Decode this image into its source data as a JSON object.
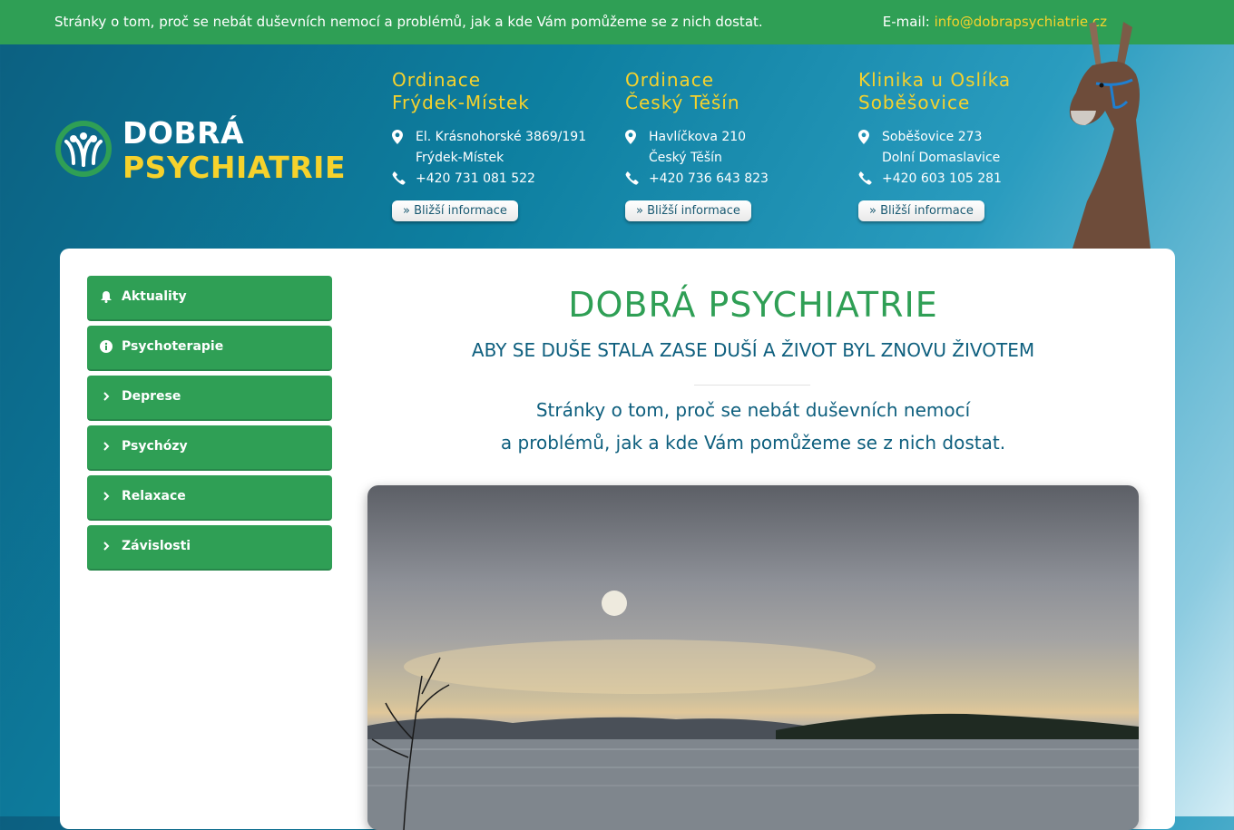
{
  "topbar": {
    "tagline": "Stránky o tom, proč se nebát duševních nemocí a problémů, jak a kde Vám pomůžeme se z nich dostat.",
    "email_label": "E-mail:",
    "email": "info@dobrapsychiatrie.cz"
  },
  "logo": {
    "line1": "DOBRÁ",
    "line2": "PSYCHIATRIE"
  },
  "clinics": [
    {
      "title1": "Ordinace",
      "title2": "Frýdek-Místek",
      "addr1": "El. Krásnohorské 3869/191",
      "addr2": "Frýdek-Místek",
      "phone": "+420 731 081 522",
      "button": "Bližší informace"
    },
    {
      "title1": "Ordinace",
      "title2": "Český Těšín",
      "addr1": "Havlíčkova 210",
      "addr2": "Český Těšín",
      "phone": "+420 736 643 823",
      "button": "Bližší informace"
    },
    {
      "title1": "Klinika u Oslíka",
      "title2": "Soběšovice",
      "addr1": "Soběšovice 273",
      "addr2": "Dolní Domaslavice",
      "phone": "+420 603 105 281",
      "button": "Bližší informace"
    }
  ],
  "menu": [
    {
      "label": "Aktuality",
      "icon": "bell-icon"
    },
    {
      "label": "Psychoterapie",
      "icon": "info-icon"
    },
    {
      "label": "Deprese",
      "icon": "chevron-right-icon"
    },
    {
      "label": "Psychózy",
      "icon": "chevron-right-icon"
    },
    {
      "label": "Relaxace",
      "icon": "chevron-right-icon"
    },
    {
      "label": "Závislosti",
      "icon": "chevron-right-icon"
    }
  ],
  "content": {
    "title": "DOBRÁ PSYCHIATRIE",
    "subtitle": "ABY SE DUŠE STALA ZASE DUŠÍ A ŽIVOT BYL ZNOVU ŽIVOTEM",
    "intro_line1": "Stránky o tom, proč se nebát duševních nemocí",
    "intro_line2": "a problémů, jak a kde Vám pomůžeme se z nich dostat."
  },
  "colors": {
    "green": "#2f9f55",
    "yellow": "#f6d22c",
    "teal": "#0e5f7e"
  }
}
